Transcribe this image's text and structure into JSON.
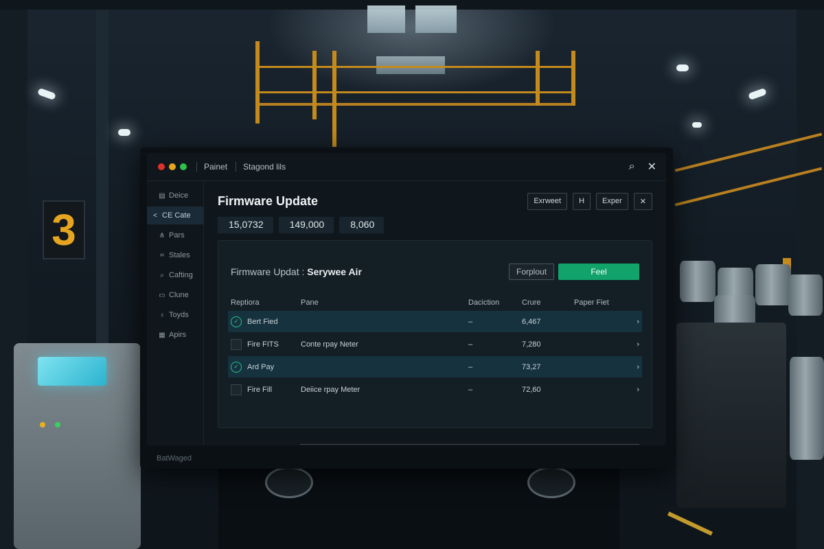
{
  "window": {
    "title_tab1": "Painet",
    "title_tab2": "Stagond lils"
  },
  "sidebar": {
    "items": [
      {
        "icon": "▤",
        "label": "Deice"
      },
      {
        "icon": "<",
        "label": "CE Cate"
      },
      {
        "icon": "⋔",
        "label": "Pars"
      },
      {
        "icon": "⌗",
        "label": "Stales"
      },
      {
        "icon": "⌕",
        "label": "Cafting"
      },
      {
        "icon": "▭",
        "label": "Clune"
      },
      {
        "icon": "♁",
        "label": "Toyds"
      },
      {
        "icon": "▦",
        "label": "Apirs"
      }
    ]
  },
  "main": {
    "title": "Firmware Update",
    "actions": {
      "a1": "Exrweet",
      "a2": "H",
      "a3": "Exper",
      "a4": "✕"
    },
    "stats": [
      "15,0732",
      "149,000",
      "8,060"
    ]
  },
  "panel": {
    "title_prefix": "Firmware Updat :",
    "title_bold": "Serywee Air",
    "btn_secondary": "Forplout",
    "btn_primary": "Feel",
    "columns": {
      "c1": "Reptiora",
      "c2": "Pane",
      "c3": "Daciction",
      "c4": "Crure",
      "c5": "Paper Fiet"
    },
    "rows": [
      {
        "name": "Bert Fied",
        "pane": "",
        "dash": "–",
        "value": "6,467",
        "chev": "›"
      },
      {
        "name": "Fire FITS",
        "pane": "Conte rpay Neter",
        "dash": "–",
        "value": "7,280",
        "chev": "›"
      },
      {
        "name": "Ard Pay",
        "pane": "",
        "dash": "–",
        "value": "73,27",
        "chev": "›"
      },
      {
        "name": "Fire Fill",
        "pane": "Deiice rpay Meter",
        "dash": "–",
        "value": "72,60",
        "chev": "›"
      }
    ]
  },
  "monitor": {
    "brand": "BatWaged"
  },
  "background": {
    "sign_number": "3"
  },
  "colors": {
    "accent": "#11a36a",
    "dot_red": "#e0302a",
    "dot_yellow": "#e8a620",
    "dot_green": "#2ec24a"
  }
}
